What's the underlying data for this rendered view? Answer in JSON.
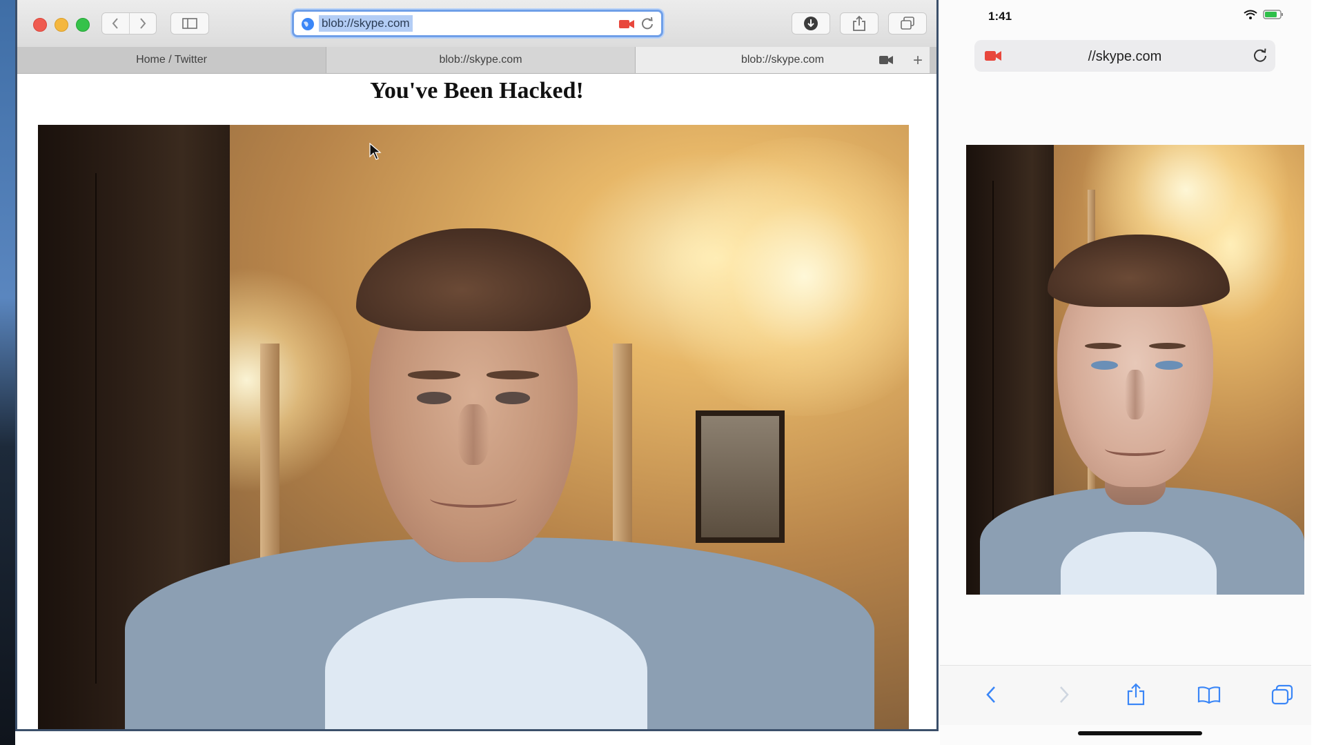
{
  "desktop": {
    "address_bar": {
      "url": "blob://skype.com"
    },
    "tabs": [
      {
        "label": "Home / Twitter"
      },
      {
        "label": "blob://skype.com"
      },
      {
        "label": "blob://skype.com"
      }
    ],
    "page": {
      "title": "You've Been Hacked!"
    }
  },
  "phone": {
    "status": {
      "time": "1:41"
    },
    "address_bar": {
      "url": "//skype.com"
    }
  },
  "colors": {
    "address_focus": "#6f9fe8",
    "camera_indicator": "#e8473c",
    "ios_accent": "#3a86f7"
  }
}
